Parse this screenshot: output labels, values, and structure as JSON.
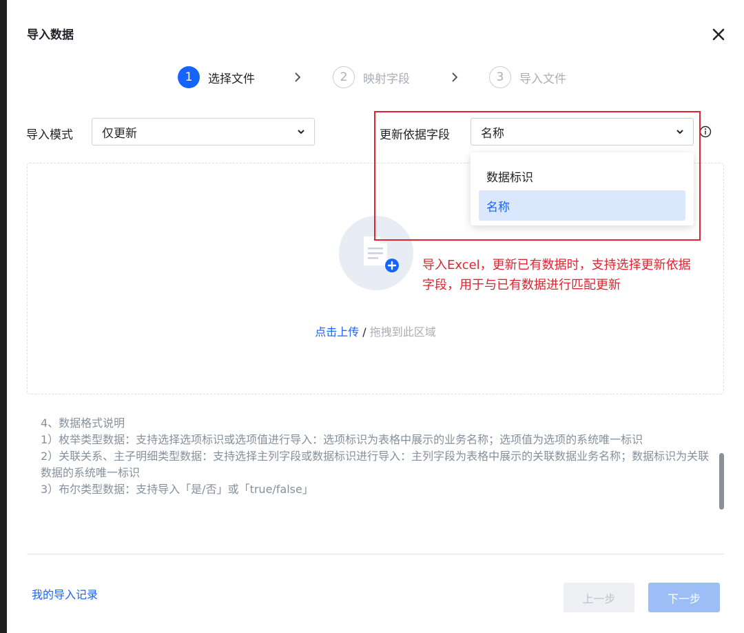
{
  "dialog": {
    "title": "导入数据",
    "close_icon": "close-icon"
  },
  "steps": [
    {
      "number": "1",
      "label": "选择文件",
      "state": "active"
    },
    {
      "number": "2",
      "label": "映射字段",
      "state": "inactive"
    },
    {
      "number": "3",
      "label": "导入文件",
      "state": "inactive"
    }
  ],
  "import_mode": {
    "label": "导入模式",
    "value": "仅更新"
  },
  "update_basis": {
    "label": "更新依据字段",
    "value": "名称",
    "options": [
      "数据标识",
      "名称"
    ],
    "selected_option": "名称"
  },
  "upload": {
    "link_text": "点击上传",
    "separator": " / ",
    "drag_text": "拖拽到此区域"
  },
  "annotation": {
    "text": "导入Excel，更新已有数据时，支持选择更新依据字段，用于与已有数据进行匹配更新"
  },
  "notes": {
    "heading": "4、数据格式说明",
    "items": [
      " 1）枚举类型数据：支持选择选项标识或选项值进行导入：选项标识为表格中展示的业务名称；选项值为选项的系统唯一标识",
      " 2）关联关系、主子明细类型数据：支持选择主列字段或数据标识进行导入：主列字段为表格中展示的关联数据业务名称；数据标识为关联数据的系统唯一标识",
      " 3）布尔类型数据：支持导入「是/否」或「true/false」"
    ]
  },
  "footer": {
    "history_link": "我的导入记录",
    "prev_button": "上一步",
    "next_button": "下一步"
  },
  "colors": {
    "primary": "#1664ff",
    "annotation_red": "#e0242f",
    "muted_text": "#86909c"
  }
}
